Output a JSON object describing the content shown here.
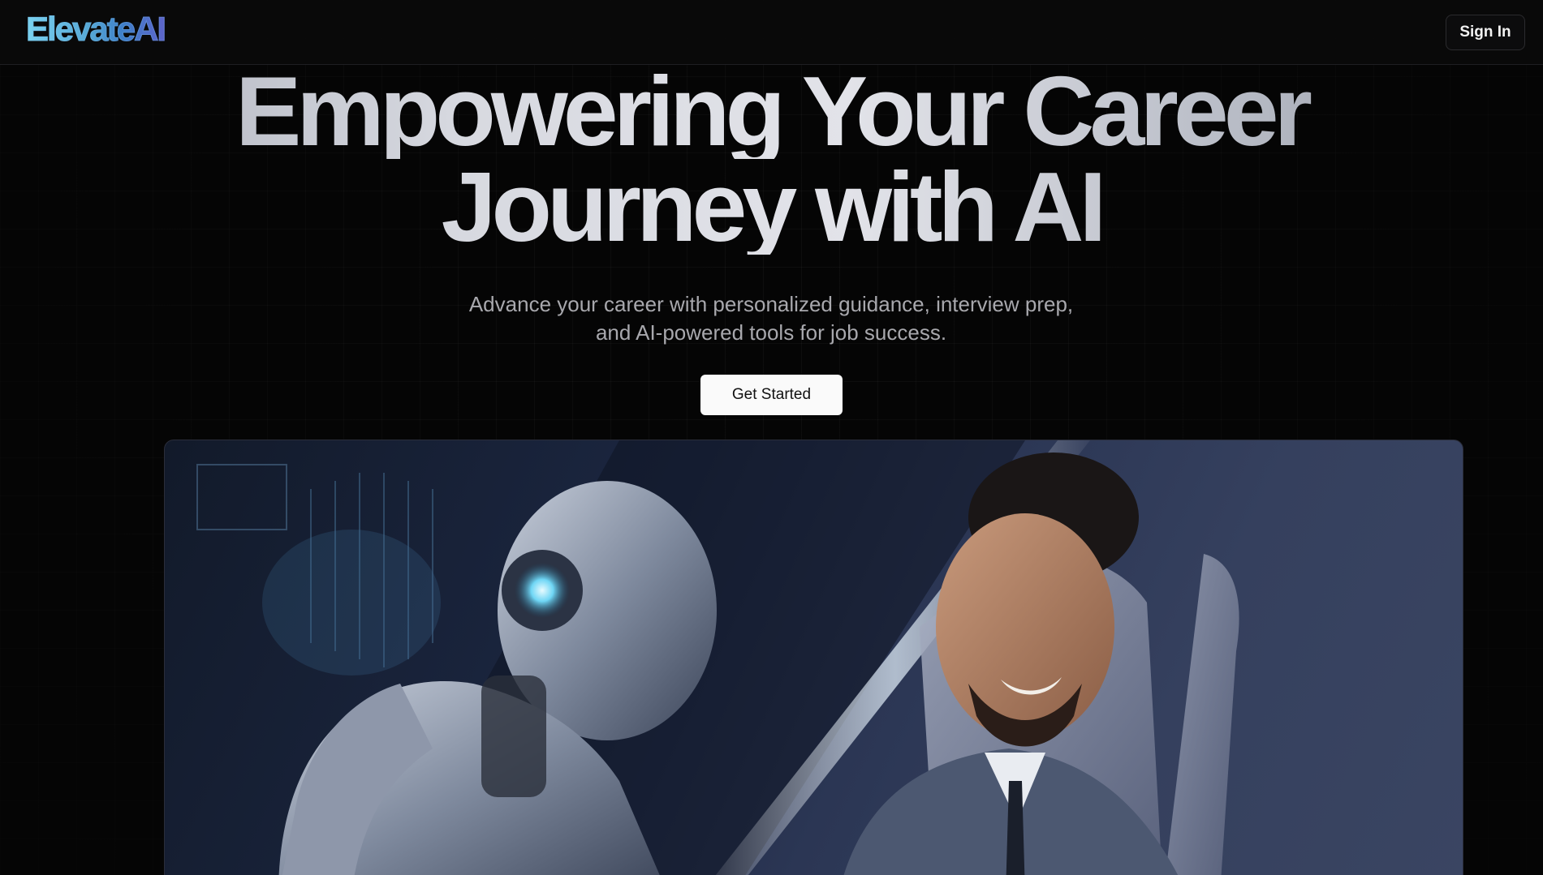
{
  "navbar": {
    "logo_text": "ElevateAI",
    "signin_label": "Sign In"
  },
  "hero": {
    "title_line1": "Empowering Your Career",
    "title_line2": "Journey with AI",
    "subtitle": "Advance your career with personalized guidance, interview prep, and AI-powered tools for job success.",
    "cta_label": "Get Started",
    "image_alt": "Humanoid robot working beside a smiling man in a suit seated in a chair"
  },
  "colors": {
    "background": "#050505",
    "cta_background": "#fafafa",
    "logo_gradient_start": "#7ad3f0",
    "logo_gradient_end": "#5d63c9",
    "subtitle_text": "#a8a8ad"
  }
}
